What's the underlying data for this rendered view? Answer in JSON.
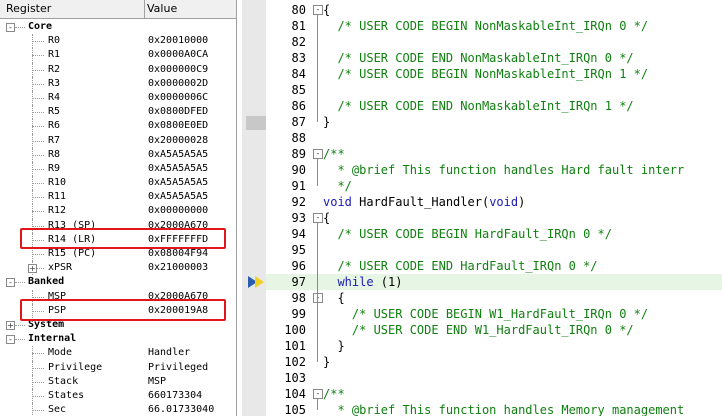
{
  "register_panel": {
    "header": {
      "col_register": "Register",
      "col_value": "Value"
    },
    "rows": [
      {
        "name": "Core",
        "value": "",
        "kind": "group",
        "expanded": "-"
      },
      {
        "name": "R0",
        "value": "0x20010000"
      },
      {
        "name": "R1",
        "value": "0x0000A0CA"
      },
      {
        "name": "R2",
        "value": "0x000000C9"
      },
      {
        "name": "R3",
        "value": "0x0000002D"
      },
      {
        "name": "R4",
        "value": "0x0000006C"
      },
      {
        "name": "R5",
        "value": "0x0800DFED"
      },
      {
        "name": "R6",
        "value": "0x0800E0ED"
      },
      {
        "name": "R7",
        "value": "0x20000028"
      },
      {
        "name": "R8",
        "value": "0xA5A5A5A5"
      },
      {
        "name": "R9",
        "value": "0xA5A5A5A5"
      },
      {
        "name": "R10",
        "value": "0xA5A5A5A5"
      },
      {
        "name": "R11",
        "value": "0xA5A5A5A5"
      },
      {
        "name": "R12",
        "value": "0x00000000"
      },
      {
        "name": "R13 (SP)",
        "value": "0x2000A670"
      },
      {
        "name": "R14 (LR)",
        "value": "0xFFFFFFFD"
      },
      {
        "name": "R15 (PC)",
        "value": "0x08004F94"
      },
      {
        "name": "xPSR",
        "value": "0x21000003",
        "expander": "+"
      },
      {
        "name": "Banked",
        "value": "",
        "kind": "group",
        "expanded": "-"
      },
      {
        "name": "MSP",
        "value": "0x2000A670"
      },
      {
        "name": "PSP",
        "value": "0x200019A8"
      },
      {
        "name": "System",
        "value": "",
        "kind": "group",
        "expanded": "+"
      },
      {
        "name": "Internal",
        "value": "",
        "kind": "group",
        "expanded": "-"
      },
      {
        "name": "Mode",
        "value": "Handler"
      },
      {
        "name": "Privilege",
        "value": "Privileged"
      },
      {
        "name": "Stack",
        "value": "MSP"
      },
      {
        "name": "States",
        "value": "660173304"
      },
      {
        "name": "Sec",
        "value": "66.01733040"
      }
    ]
  },
  "editor": {
    "current_line": "97",
    "lines": [
      {
        "num": "80",
        "code": "{",
        "fold": "-"
      },
      {
        "num": "81",
        "code": "  /* USER CODE BEGIN NonMaskableInt_IRQn 0 */",
        "style": "comment"
      },
      {
        "num": "82",
        "code": ""
      },
      {
        "num": "83",
        "code": "  /* USER CODE END NonMaskableInt_IRQn 0 */",
        "style": "comment"
      },
      {
        "num": "84",
        "code": "  /* USER CODE BEGIN NonMaskableInt_IRQn 1 */",
        "style": "comment"
      },
      {
        "num": "85",
        "code": ""
      },
      {
        "num": "86",
        "code": "  /* USER CODE END NonMaskableInt_IRQn 1 */",
        "style": "comment"
      },
      {
        "num": "87",
        "code": "}"
      },
      {
        "num": "88",
        "code": ""
      },
      {
        "num": "89",
        "code": "/**",
        "style": "comment",
        "fold": "-"
      },
      {
        "num": "90",
        "code": "  * @brief This function handles Hard fault interr",
        "style": "comment"
      },
      {
        "num": "91",
        "code": "  */",
        "style": "comment"
      },
      {
        "num": "92",
        "code": "void HardFault_Handler(void)",
        "style": "signature"
      },
      {
        "num": "93",
        "code": "{",
        "fold": "-"
      },
      {
        "num": "94",
        "code": "  /* USER CODE BEGIN HardFault_IRQn 0 */",
        "style": "comment"
      },
      {
        "num": "95",
        "code": ""
      },
      {
        "num": "96",
        "code": "  /* USER CODE END HardFault_IRQn 0 */",
        "style": "comment"
      },
      {
        "num": "97",
        "code": "  while (1)",
        "style": "while"
      },
      {
        "num": "98",
        "code": "  {",
        "fold": "-"
      },
      {
        "num": "99",
        "code": "    /* USER CODE BEGIN W1_HardFault_IRQn 0 */",
        "style": "comment"
      },
      {
        "num": "100",
        "code": "    /* USER CODE END W1_HardFault_IRQn 0 */",
        "style": "comment"
      },
      {
        "num": "101",
        "code": "  }"
      },
      {
        "num": "102",
        "code": "}"
      },
      {
        "num": "103",
        "code": ""
      },
      {
        "num": "104",
        "code": "/**",
        "style": "comment",
        "fold": "-"
      },
      {
        "num": "105",
        "code": "  * @brief This function handles Memory management",
        "style": "comment"
      }
    ]
  }
}
